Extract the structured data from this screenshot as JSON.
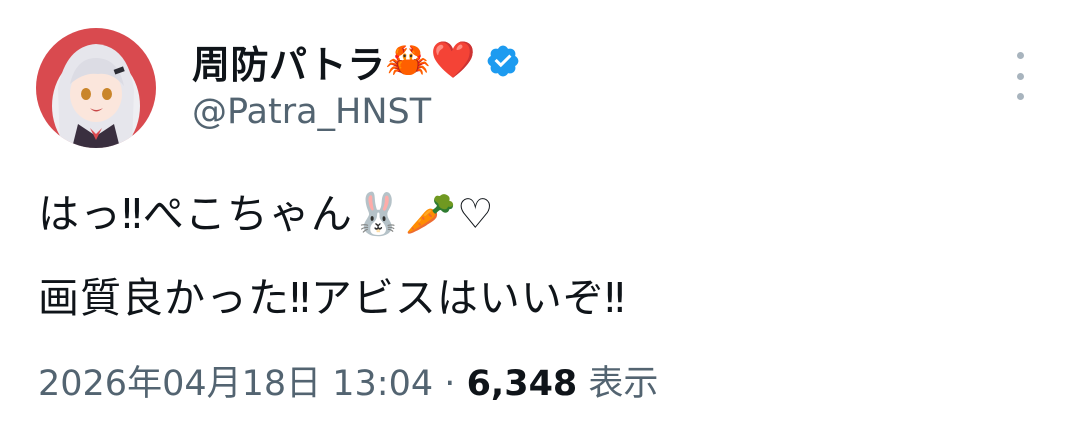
{
  "tweet": {
    "author": {
      "display_name": "周防パトラ",
      "name_emojis": "🦀❤️",
      "handle": "@Patra_HNST",
      "verified": true
    },
    "text_line1": "はっ‼ぺこちゃん🐰🥕♡",
    "text_line2": "画質良かった‼アビスはいいぞ‼",
    "timestamp": "2026年04月18日 13:04",
    "separator": "·",
    "views_count": "6,348",
    "views_label": "表示"
  },
  "colors": {
    "text_primary": "#0f1419",
    "text_secondary": "#536471",
    "verified_blue": "#1d9bf0"
  },
  "icons": {
    "verified": "verified-badge-icon",
    "more": "more-vertical-icon"
  }
}
